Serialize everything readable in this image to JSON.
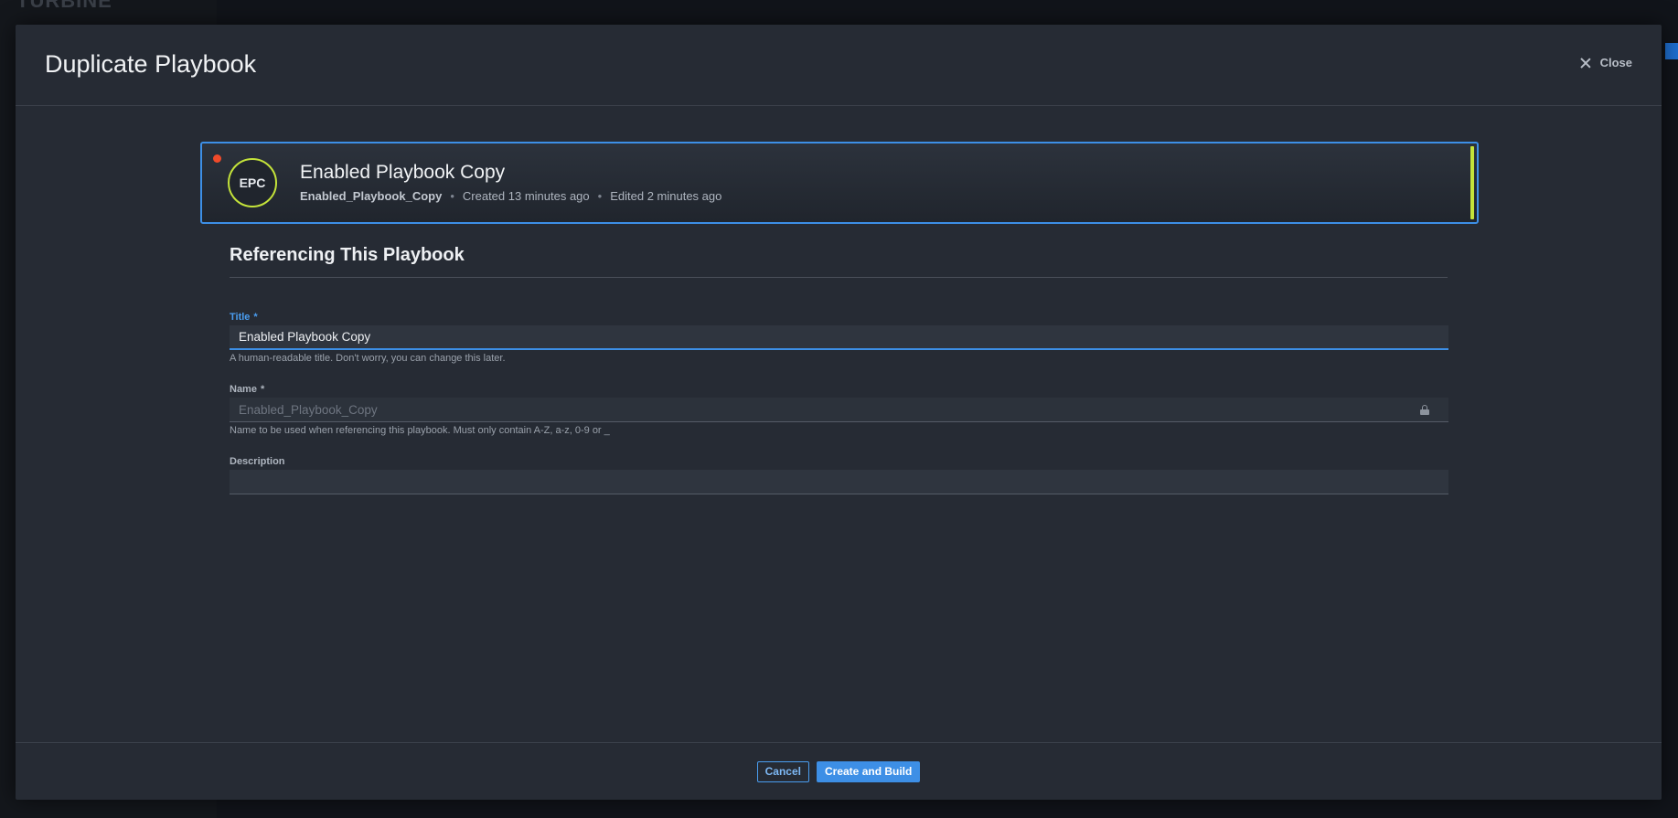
{
  "background": {
    "logo": "TURBINE"
  },
  "modal": {
    "title": "Duplicate Playbook",
    "close_label": "Close",
    "playbook_card": {
      "initials": "EPC",
      "title": "Enabled Playbook Copy",
      "name": "Enabled_Playbook_Copy",
      "created": "Created 13 minutes ago",
      "edited": "Edited 2 minutes ago",
      "separator": "•",
      "status_color": "#f04a2a",
      "accent_color": "#c4e33a"
    },
    "section_title": "Referencing This Playbook",
    "fields": {
      "title": {
        "label": "Title",
        "required_mark": "*",
        "value": "Enabled Playbook Copy",
        "help": "A human-readable title. Don't worry, you can change this later."
      },
      "name": {
        "label": "Name",
        "required_mark": "*",
        "value": "Enabled_Playbook_Copy",
        "help": "Name to be used when referencing this playbook. Must only contain A-Z, a-z, 0-9 or _",
        "icon": "lock-icon"
      },
      "description": {
        "label": "Description",
        "value": ""
      }
    },
    "footer": {
      "cancel_label": "Cancel",
      "primary_label": "Create and Build"
    }
  }
}
